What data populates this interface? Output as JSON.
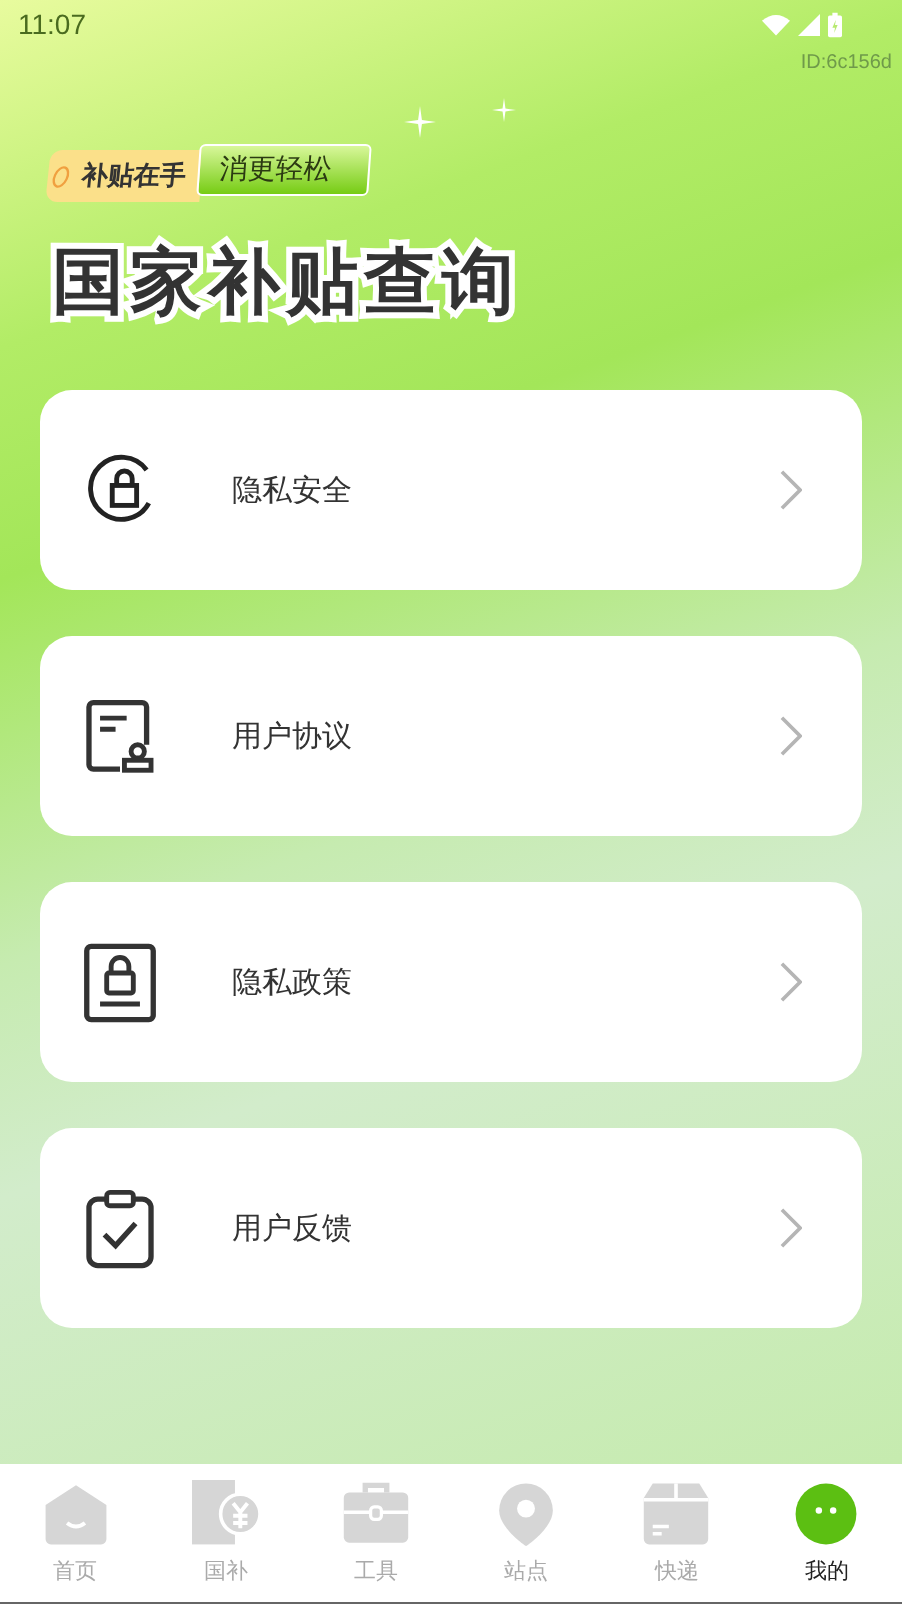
{
  "status_bar": {
    "time": "11:07"
  },
  "device_id": "ID:6c156d",
  "banner": {
    "tag_primary": "补贴在手",
    "tag_secondary": "消更轻松",
    "title": "国家补贴查询"
  },
  "menu": [
    {
      "label": "隐私安全"
    },
    {
      "label": "用户协议"
    },
    {
      "label": "隐私政策"
    },
    {
      "label": "用户反馈"
    }
  ],
  "tab_bar": [
    {
      "label": "首页",
      "selected": false
    },
    {
      "label": "国补",
      "selected": false
    },
    {
      "label": "工具",
      "selected": false
    },
    {
      "label": "站点",
      "selected": false
    },
    {
      "label": "快递",
      "selected": false
    },
    {
      "label": "我的",
      "selected": true
    }
  ]
}
